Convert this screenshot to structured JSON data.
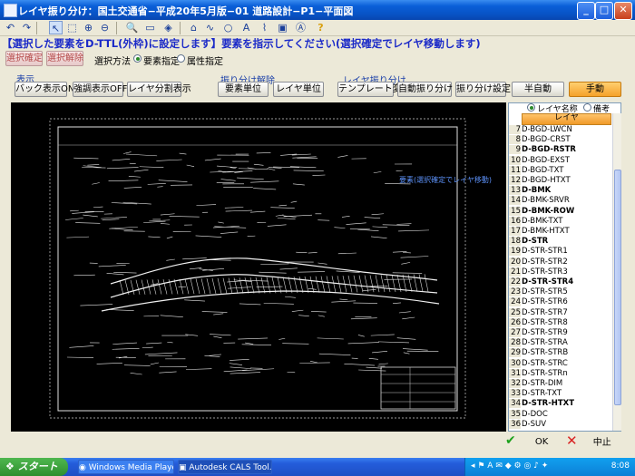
{
  "window": {
    "title": "レイヤ振り分け：国土交通省−平成20年5月版−01 道路設計−P1−平面図"
  },
  "toolbar": {
    "icons": [
      "undo-icon",
      "redo-icon",
      "pointer-icon",
      "select-icon",
      "select-add-icon",
      "select-remove-icon",
      "zoom-icon",
      "page-icon",
      "layers-icon",
      "window-icon",
      "line-icon",
      "circle-icon",
      "text-icon",
      "polyline-icon",
      "image-icon",
      "text2-icon",
      "help-icon"
    ]
  },
  "instruction": "【選択した要素をD-TTL(外枠)に設定します】要素を指示してください(選択確定でレイヤ移動します)",
  "row1": {
    "confirm_label": "選択確定",
    "release_label": "選択解除",
    "method_label": "選択方法",
    "radio_element": "要素指定",
    "radio_attribute": "属性指定"
  },
  "display": {
    "group_label": "表示",
    "back_label": "バック表示ON",
    "emph_label": "強調表示OFF",
    "split_label": "レイヤ分割表示"
  },
  "unassign": {
    "group_label": "振り分け解除",
    "element_label": "要素単位",
    "layer_label": "レイヤ単位"
  },
  "assign": {
    "group_label": "レイヤ振り分け",
    "template_label": "テンプレート変更",
    "auto_label": "自動振り分け",
    "settings_label": "振り分け設定",
    "semi_label": "半自動",
    "manual_label": "手動"
  },
  "canvas": {
    "annotation": "要素(選択確定でレイヤ移動)"
  },
  "layers": {
    "radio_name": "レイヤ名称",
    "radio_note": "備考",
    "column_label": "レイヤ",
    "rows": [
      {
        "n": "7",
        "name": "D-BGD-LWCN",
        "bold": false
      },
      {
        "n": "8",
        "name": "D-BGD-CRST",
        "bold": false
      },
      {
        "n": "9",
        "name": "D-BGD-RSTR",
        "bold": true
      },
      {
        "n": "10",
        "name": "D-BGD-EXST",
        "bold": false
      },
      {
        "n": "11",
        "name": "D-BGD-TXT",
        "bold": false
      },
      {
        "n": "12",
        "name": "D-BGD-HTXT",
        "bold": false
      },
      {
        "n": "13",
        "name": "D-BMK",
        "bold": true
      },
      {
        "n": "14",
        "name": "D-BMK-SRVR",
        "bold": false
      },
      {
        "n": "15",
        "name": "D-BMK-ROW",
        "bold": true
      },
      {
        "n": "16",
        "name": "D-BMK-TXT",
        "bold": false
      },
      {
        "n": "17",
        "name": "D-BMK-HTXT",
        "bold": false
      },
      {
        "n": "18",
        "name": "D-STR",
        "bold": true
      },
      {
        "n": "19",
        "name": "D-STR-STR1",
        "bold": false
      },
      {
        "n": "20",
        "name": "D-STR-STR2",
        "bold": false
      },
      {
        "n": "21",
        "name": "D-STR-STR3",
        "bold": false
      },
      {
        "n": "22",
        "name": "D-STR-STR4",
        "bold": true
      },
      {
        "n": "23",
        "name": "D-STR-STR5",
        "bold": false
      },
      {
        "n": "24",
        "name": "D-STR-STR6",
        "bold": false
      },
      {
        "n": "25",
        "name": "D-STR-STR7",
        "bold": false
      },
      {
        "n": "26",
        "name": "D-STR-STR8",
        "bold": false
      },
      {
        "n": "27",
        "name": "D-STR-STR9",
        "bold": false
      },
      {
        "n": "28",
        "name": "D-STR-STRA",
        "bold": false
      },
      {
        "n": "29",
        "name": "D-STR-STRB",
        "bold": false
      },
      {
        "n": "30",
        "name": "D-STR-STRC",
        "bold": false
      },
      {
        "n": "31",
        "name": "D-STR-STRn",
        "bold": false
      },
      {
        "n": "32",
        "name": "D-STR-DIM",
        "bold": false
      },
      {
        "n": "33",
        "name": "D-STR-TXT",
        "bold": false
      },
      {
        "n": "34",
        "name": "D-STR-HTXT",
        "bold": true
      },
      {
        "n": "35",
        "name": "D-DOC",
        "bold": false
      },
      {
        "n": "36",
        "name": "D-SUV",
        "bold": false
      }
    ]
  },
  "bottom": {
    "ok_label": "OK",
    "cancel_label": "中止"
  },
  "taskbar": {
    "start_label": "スタート",
    "tasks": [
      "Windows Media Player",
      "Autodesk CALS Tool..."
    ],
    "clock": "8:08"
  },
  "colors": {
    "accent": "#f5a12a",
    "instruction": "#1b2ac8",
    "canvas_bg": "#000000"
  }
}
